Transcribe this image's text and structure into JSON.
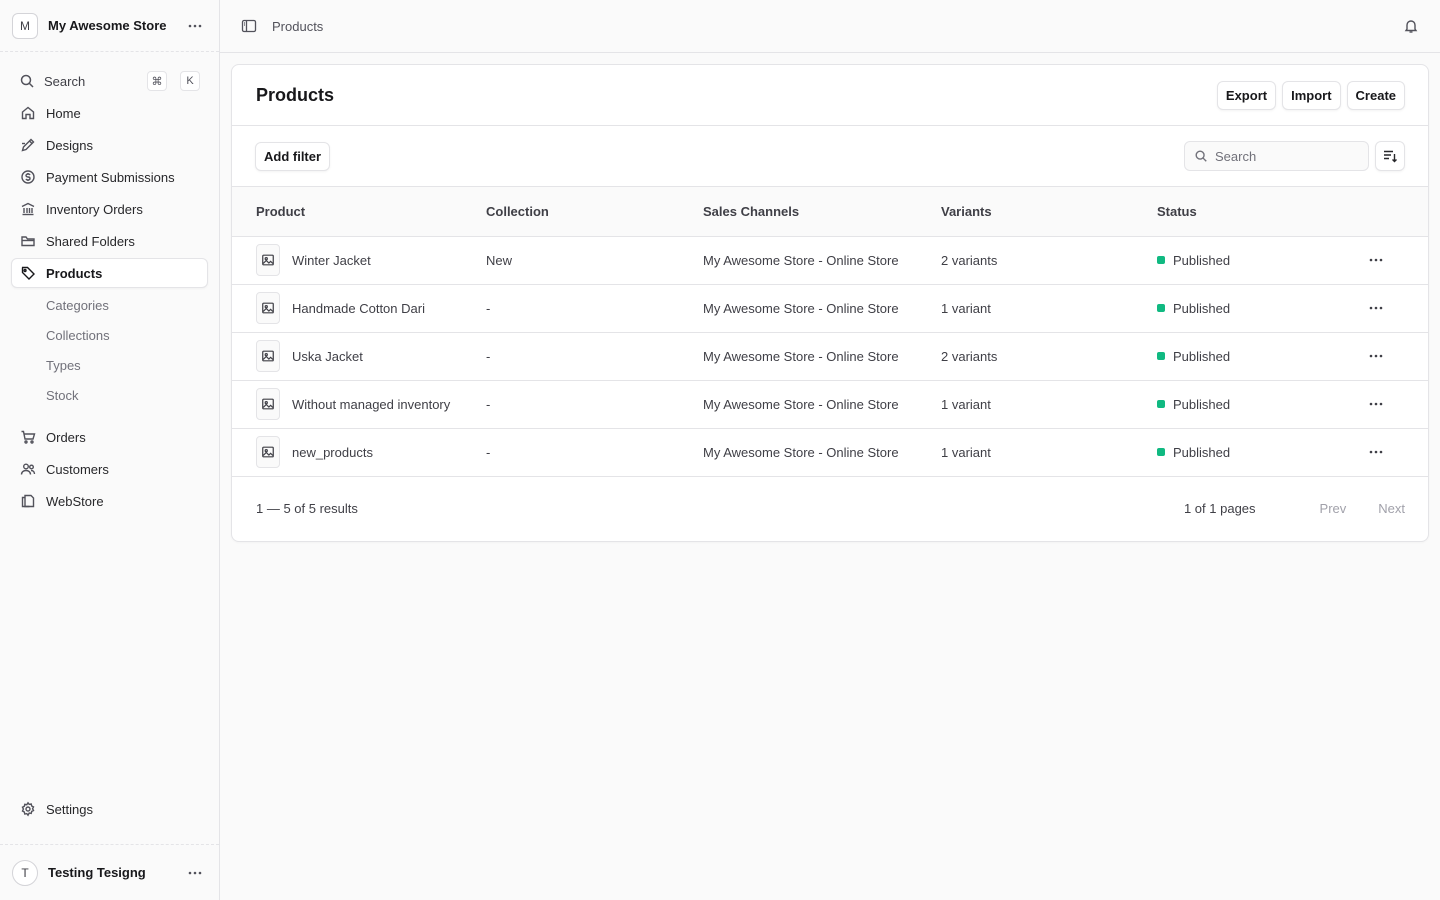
{
  "sidebar": {
    "store": {
      "avatar": "M",
      "name": "My Awesome Store",
      "menu_icon": "more-horizontal-icon"
    },
    "search": {
      "label": "Search",
      "shortcut_mod": "⌘",
      "shortcut_key": "K"
    },
    "items": [
      {
        "label": "Home",
        "icon": "home-icon"
      },
      {
        "label": "Designs",
        "icon": "pen-icon"
      },
      {
        "label": "Payment Submissions",
        "icon": "dollar-icon"
      },
      {
        "label": "Inventory Orders",
        "icon": "building-icon"
      },
      {
        "label": "Shared Folders",
        "icon": "folder-icon"
      },
      {
        "label": "Products",
        "icon": "tag-icon",
        "active": true
      }
    ],
    "product_sub": [
      "Categories",
      "Collections",
      "Types",
      "Stock"
    ],
    "items2": [
      {
        "label": "Orders",
        "icon": "cart-icon"
      },
      {
        "label": "Customers",
        "icon": "users-icon"
      },
      {
        "label": "WebStore",
        "icon": "copy-icon"
      }
    ],
    "settings": {
      "label": "Settings",
      "icon": "gear-icon"
    },
    "user": {
      "avatar": "T",
      "name": "Testing Tesigng"
    }
  },
  "topbar": {
    "breadcrumb": "Products"
  },
  "page": {
    "title": "Products",
    "buttons": {
      "export": "Export",
      "import": "Import",
      "create": "Create"
    },
    "add_filter": "Add filter",
    "search_placeholder": "Search"
  },
  "table": {
    "headers": [
      "Product",
      "Collection",
      "Sales Channels",
      "Variants",
      "Status"
    ],
    "rows": [
      {
        "product": "Winter Jacket",
        "collection": "New",
        "channels": "My Awesome Store - Online Store",
        "variants": "2 variants",
        "status": "Published"
      },
      {
        "product": "Handmade Cotton Dari",
        "collection": "-",
        "channels": "My Awesome Store - Online Store",
        "variants": "1 variant",
        "status": "Published"
      },
      {
        "product": "Uska Jacket",
        "collection": "-",
        "channels": "My Awesome Store - Online Store",
        "variants": "2 variants",
        "status": "Published"
      },
      {
        "product": "Without managed inventory",
        "collection": "-",
        "channels": "My Awesome Store - Online Store",
        "variants": "1 variant",
        "status": "Published"
      },
      {
        "product": "new_products",
        "collection": "-",
        "channels": "My Awesome Store - Online Store",
        "variants": "1 variant",
        "status": "Published"
      }
    ]
  },
  "pagination": {
    "count": "1 — 5 of 5 results",
    "pages": "1 of 1 pages",
    "prev": "Prev",
    "next": "Next"
  },
  "colors": {
    "status_published": "#10b981",
    "border": "#e4e4e7"
  }
}
